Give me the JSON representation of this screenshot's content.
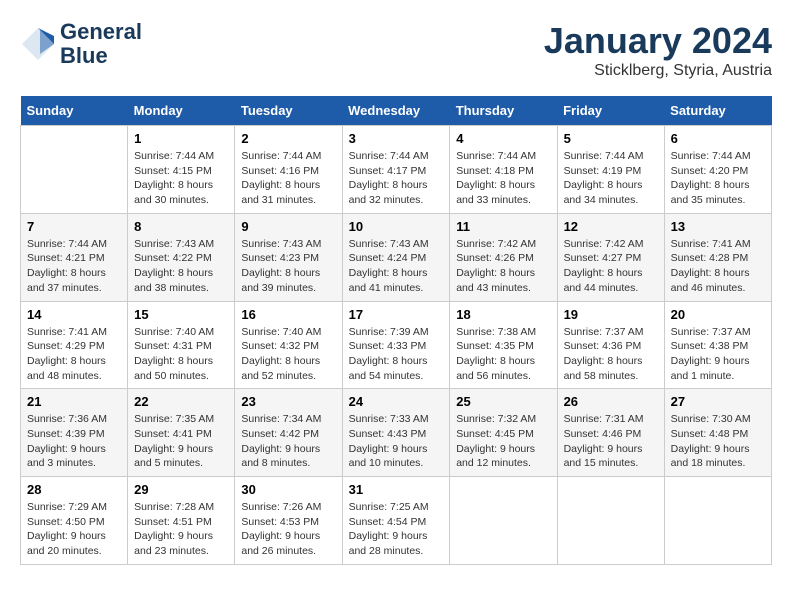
{
  "logo": {
    "line1": "General",
    "line2": "Blue"
  },
  "title": "January 2024",
  "location": "Sticklberg, Styria, Austria",
  "days_of_week": [
    "Sunday",
    "Monday",
    "Tuesday",
    "Wednesday",
    "Thursday",
    "Friday",
    "Saturday"
  ],
  "weeks": [
    [
      {
        "day": "",
        "sunrise": "",
        "sunset": "",
        "daylight": ""
      },
      {
        "day": "1",
        "sunrise": "Sunrise: 7:44 AM",
        "sunset": "Sunset: 4:15 PM",
        "daylight": "Daylight: 8 hours and 30 minutes."
      },
      {
        "day": "2",
        "sunrise": "Sunrise: 7:44 AM",
        "sunset": "Sunset: 4:16 PM",
        "daylight": "Daylight: 8 hours and 31 minutes."
      },
      {
        "day": "3",
        "sunrise": "Sunrise: 7:44 AM",
        "sunset": "Sunset: 4:17 PM",
        "daylight": "Daylight: 8 hours and 32 minutes."
      },
      {
        "day": "4",
        "sunrise": "Sunrise: 7:44 AM",
        "sunset": "Sunset: 4:18 PM",
        "daylight": "Daylight: 8 hours and 33 minutes."
      },
      {
        "day": "5",
        "sunrise": "Sunrise: 7:44 AM",
        "sunset": "Sunset: 4:19 PM",
        "daylight": "Daylight: 8 hours and 34 minutes."
      },
      {
        "day": "6",
        "sunrise": "Sunrise: 7:44 AM",
        "sunset": "Sunset: 4:20 PM",
        "daylight": "Daylight: 8 hours and 35 minutes."
      }
    ],
    [
      {
        "day": "7",
        "sunrise": "Sunrise: 7:44 AM",
        "sunset": "Sunset: 4:21 PM",
        "daylight": "Daylight: 8 hours and 37 minutes."
      },
      {
        "day": "8",
        "sunrise": "Sunrise: 7:43 AM",
        "sunset": "Sunset: 4:22 PM",
        "daylight": "Daylight: 8 hours and 38 minutes."
      },
      {
        "day": "9",
        "sunrise": "Sunrise: 7:43 AM",
        "sunset": "Sunset: 4:23 PM",
        "daylight": "Daylight: 8 hours and 39 minutes."
      },
      {
        "day": "10",
        "sunrise": "Sunrise: 7:43 AM",
        "sunset": "Sunset: 4:24 PM",
        "daylight": "Daylight: 8 hours and 41 minutes."
      },
      {
        "day": "11",
        "sunrise": "Sunrise: 7:42 AM",
        "sunset": "Sunset: 4:26 PM",
        "daylight": "Daylight: 8 hours and 43 minutes."
      },
      {
        "day": "12",
        "sunrise": "Sunrise: 7:42 AM",
        "sunset": "Sunset: 4:27 PM",
        "daylight": "Daylight: 8 hours and 44 minutes."
      },
      {
        "day": "13",
        "sunrise": "Sunrise: 7:41 AM",
        "sunset": "Sunset: 4:28 PM",
        "daylight": "Daylight: 8 hours and 46 minutes."
      }
    ],
    [
      {
        "day": "14",
        "sunrise": "Sunrise: 7:41 AM",
        "sunset": "Sunset: 4:29 PM",
        "daylight": "Daylight: 8 hours and 48 minutes."
      },
      {
        "day": "15",
        "sunrise": "Sunrise: 7:40 AM",
        "sunset": "Sunset: 4:31 PM",
        "daylight": "Daylight: 8 hours and 50 minutes."
      },
      {
        "day": "16",
        "sunrise": "Sunrise: 7:40 AM",
        "sunset": "Sunset: 4:32 PM",
        "daylight": "Daylight: 8 hours and 52 minutes."
      },
      {
        "day": "17",
        "sunrise": "Sunrise: 7:39 AM",
        "sunset": "Sunset: 4:33 PM",
        "daylight": "Daylight: 8 hours and 54 minutes."
      },
      {
        "day": "18",
        "sunrise": "Sunrise: 7:38 AM",
        "sunset": "Sunset: 4:35 PM",
        "daylight": "Daylight: 8 hours and 56 minutes."
      },
      {
        "day": "19",
        "sunrise": "Sunrise: 7:37 AM",
        "sunset": "Sunset: 4:36 PM",
        "daylight": "Daylight: 8 hours and 58 minutes."
      },
      {
        "day": "20",
        "sunrise": "Sunrise: 7:37 AM",
        "sunset": "Sunset: 4:38 PM",
        "daylight": "Daylight: 9 hours and 1 minute."
      }
    ],
    [
      {
        "day": "21",
        "sunrise": "Sunrise: 7:36 AM",
        "sunset": "Sunset: 4:39 PM",
        "daylight": "Daylight: 9 hours and 3 minutes."
      },
      {
        "day": "22",
        "sunrise": "Sunrise: 7:35 AM",
        "sunset": "Sunset: 4:41 PM",
        "daylight": "Daylight: 9 hours and 5 minutes."
      },
      {
        "day": "23",
        "sunrise": "Sunrise: 7:34 AM",
        "sunset": "Sunset: 4:42 PM",
        "daylight": "Daylight: 9 hours and 8 minutes."
      },
      {
        "day": "24",
        "sunrise": "Sunrise: 7:33 AM",
        "sunset": "Sunset: 4:43 PM",
        "daylight": "Daylight: 9 hours and 10 minutes."
      },
      {
        "day": "25",
        "sunrise": "Sunrise: 7:32 AM",
        "sunset": "Sunset: 4:45 PM",
        "daylight": "Daylight: 9 hours and 12 minutes."
      },
      {
        "day": "26",
        "sunrise": "Sunrise: 7:31 AM",
        "sunset": "Sunset: 4:46 PM",
        "daylight": "Daylight: 9 hours and 15 minutes."
      },
      {
        "day": "27",
        "sunrise": "Sunrise: 7:30 AM",
        "sunset": "Sunset: 4:48 PM",
        "daylight": "Daylight: 9 hours and 18 minutes."
      }
    ],
    [
      {
        "day": "28",
        "sunrise": "Sunrise: 7:29 AM",
        "sunset": "Sunset: 4:50 PM",
        "daylight": "Daylight: 9 hours and 20 minutes."
      },
      {
        "day": "29",
        "sunrise": "Sunrise: 7:28 AM",
        "sunset": "Sunset: 4:51 PM",
        "daylight": "Daylight: 9 hours and 23 minutes."
      },
      {
        "day": "30",
        "sunrise": "Sunrise: 7:26 AM",
        "sunset": "Sunset: 4:53 PM",
        "daylight": "Daylight: 9 hours and 26 minutes."
      },
      {
        "day": "31",
        "sunrise": "Sunrise: 7:25 AM",
        "sunset": "Sunset: 4:54 PM",
        "daylight": "Daylight: 9 hours and 28 minutes."
      },
      {
        "day": "",
        "sunrise": "",
        "sunset": "",
        "daylight": ""
      },
      {
        "day": "",
        "sunrise": "",
        "sunset": "",
        "daylight": ""
      },
      {
        "day": "",
        "sunrise": "",
        "sunset": "",
        "daylight": ""
      }
    ]
  ]
}
